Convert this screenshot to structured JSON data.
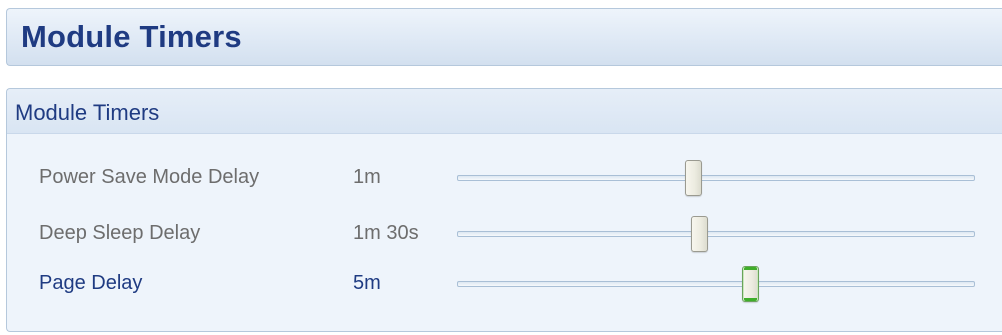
{
  "header": {
    "title": "Module Timers"
  },
  "panel": {
    "title": "Module Timers",
    "rows": [
      {
        "label": "Power Save Mode Delay",
        "value": "1m",
        "slider_fraction": 0.455,
        "active": false
      },
      {
        "label": "Deep Sleep Delay",
        "value": "1m 30s",
        "slider_fraction": 0.468,
        "active": false
      },
      {
        "label": "Page Delay",
        "value": "5m",
        "slider_fraction": 0.565,
        "active": true
      }
    ]
  },
  "colors": {
    "title_text": "#1f3b82",
    "inactive_text": "#6d6d6d",
    "active_thumb_accent": "#3fae2a",
    "panel_background": "#eef4fb"
  }
}
